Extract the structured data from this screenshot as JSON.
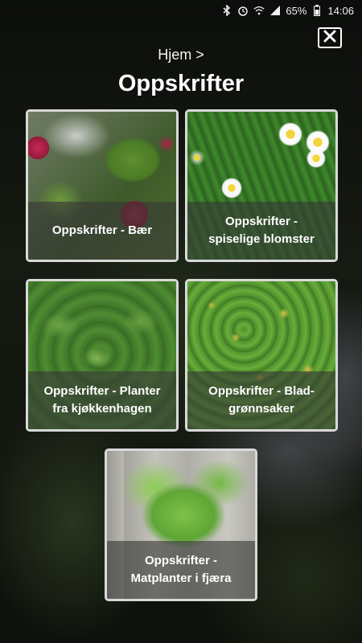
{
  "status_bar": {
    "icons": [
      "bluetooth-icon",
      "alarm-icon",
      "wifi-icon",
      "signal-icon",
      "battery-icon"
    ],
    "battery": "65%",
    "time": "14:06"
  },
  "header": {
    "breadcrumb": "Hjem >",
    "title": "Oppskrifter",
    "close_icon": "close-icon"
  },
  "tiles": [
    {
      "lines": [
        "Oppskrifter - Bær"
      ],
      "image": "raspberries"
    },
    {
      "lines": [
        "Oppskrifter -",
        "spiselige blomster"
      ],
      "image": "daisies"
    },
    {
      "lines": [
        "Oppskrifter - Planter",
        "fra kjøkkenhagen"
      ],
      "image": "basil"
    },
    {
      "lines": [
        "Oppskrifter - Blad-",
        "grønnsaker"
      ],
      "image": "leafy-greens"
    },
    {
      "lines": [
        "Oppskrifter -",
        "Matplanter i fjæra"
      ],
      "image": "seaweed"
    }
  ]
}
